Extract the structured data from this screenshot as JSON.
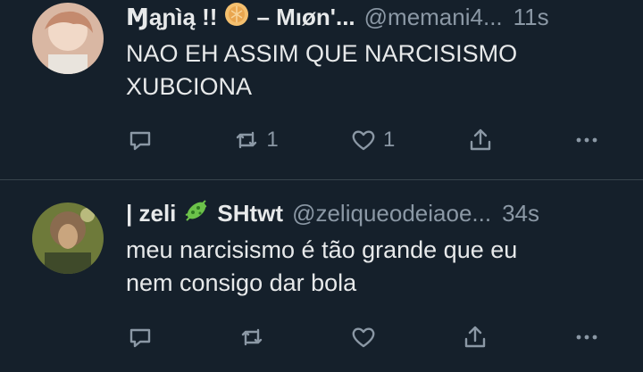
{
  "tweets": [
    {
      "name_prefix": "Ɱąɲìą !!",
      "name_suffix": "– Mıøn'...",
      "handle": "@memani4...",
      "time": "11s",
      "text_lines": [
        "NAO EH ASSIM QUE NARCISISMO",
        "XUBCIONA"
      ],
      "reply_count": "",
      "retweet_count": "1",
      "like_count": "1"
    },
    {
      "name_prefix": "| zeli",
      "name_suffix": "SHtwt",
      "handle": "@zeliqueodeiaoe...",
      "time": "34s",
      "text_lines": [
        "meu narcisismo é tão grande que eu",
        "nem consigo dar bola"
      ],
      "reply_count": "",
      "retweet_count": "",
      "like_count": ""
    }
  ],
  "icons": {
    "reply": "reply-icon",
    "retweet": "retweet-icon",
    "like": "heart-icon",
    "share": "share-icon",
    "more": "more-icon",
    "emoji1": "waffle-emoji-icon",
    "emoji2": "microbe-emoji-icon"
  }
}
